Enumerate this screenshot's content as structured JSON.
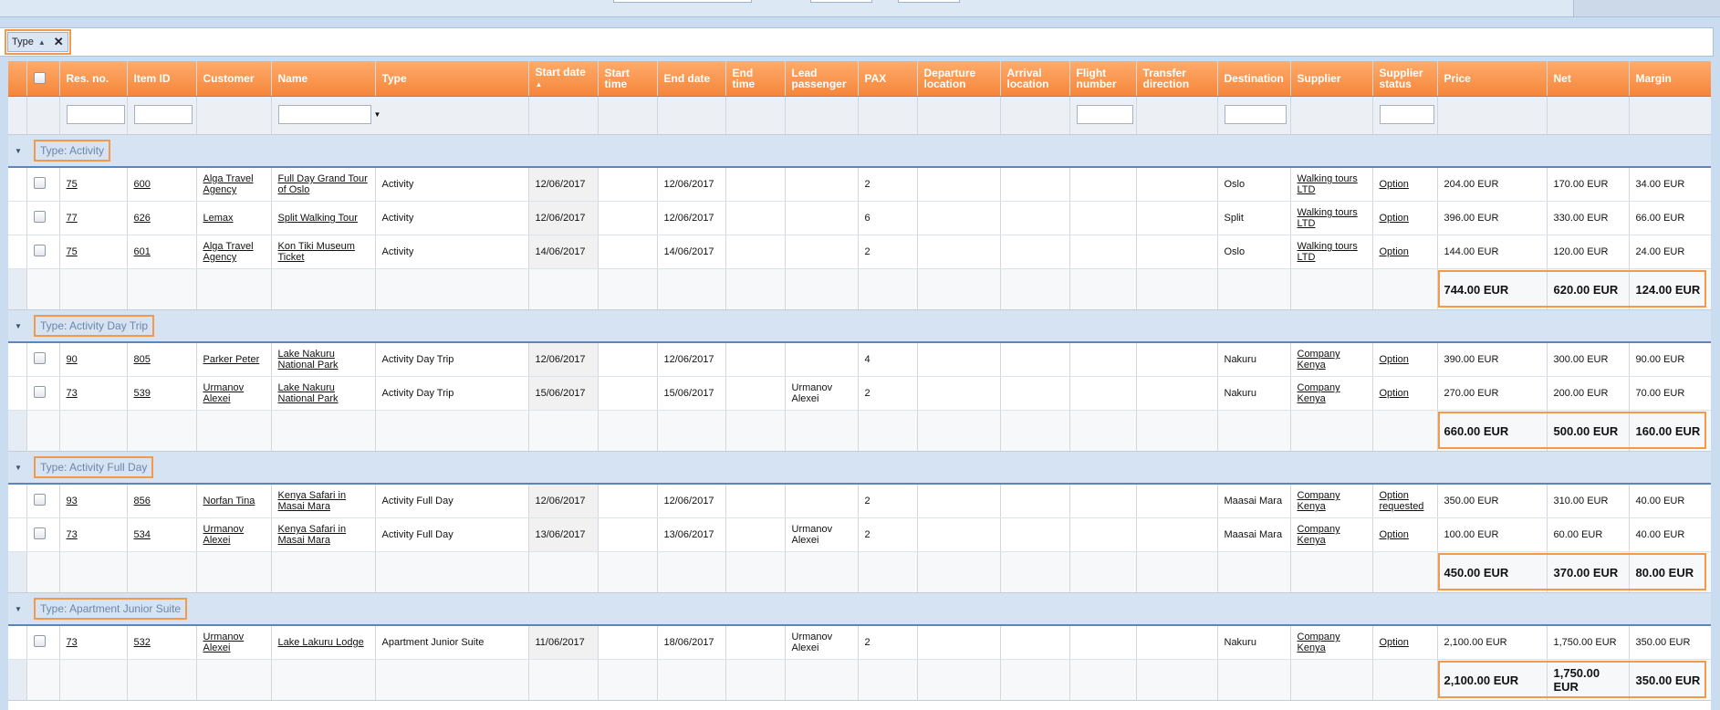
{
  "group_panel": {
    "chip_label": "Type"
  },
  "columns": [
    "",
    "",
    "Res. no.",
    "Item ID",
    "Customer",
    "Name",
    "Type",
    "Start date",
    "Start time",
    "End date",
    "End time",
    "Lead passenger",
    "PAX",
    "Departure location",
    "Arrival location",
    "Flight number",
    "Transfer direction",
    "Destination",
    "Supplier",
    "Supplier status",
    "Price",
    "Net",
    "Margin"
  ],
  "groups": [
    {
      "label": "Type: Activity",
      "rows": [
        [
          "75",
          "600",
          "Alga Travel Agency",
          "Full Day Grand Tour of Oslo",
          "Activity",
          "12/06/2017",
          "",
          "12/06/2017",
          "",
          "",
          "2",
          "",
          "",
          "",
          "",
          "Oslo",
          "Walking tours LTD",
          "Option",
          "204.00 EUR",
          "170.00 EUR",
          "34.00 EUR"
        ],
        [
          "77",
          "626",
          "Lemax",
          "Split Walking Tour",
          "Activity",
          "12/06/2017",
          "",
          "12/06/2017",
          "",
          "",
          "6",
          "",
          "",
          "",
          "",
          "Split",
          "Walking tours LTD",
          "Option",
          "396.00 EUR",
          "330.00 EUR",
          "66.00 EUR"
        ],
        [
          "75",
          "601",
          "Alga Travel Agency",
          "Kon Tiki Museum Ticket",
          "Activity",
          "14/06/2017",
          "",
          "14/06/2017",
          "",
          "",
          "2",
          "",
          "",
          "",
          "",
          "Oslo",
          "Walking tours LTD",
          "Option",
          "144.00 EUR",
          "120.00 EUR",
          "24.00 EUR"
        ]
      ],
      "totals": {
        "price": "744.00 EUR",
        "net": "620.00 EUR",
        "margin": "124.00 EUR"
      }
    },
    {
      "label": "Type: Activity Day Trip",
      "rows": [
        [
          "90",
          "805",
          "Parker Peter",
          "Lake Nakuru National Park",
          "Activity Day Trip",
          "12/06/2017",
          "",
          "12/06/2017",
          "",
          "",
          "4",
          "",
          "",
          "",
          "",
          "Nakuru",
          "Company Kenya",
          "Option",
          "390.00 EUR",
          "300.00 EUR",
          "90.00 EUR"
        ],
        [
          "73",
          "539",
          "Urmanov Alexei",
          "Lake Nakuru National Park",
          "Activity Day Trip",
          "15/06/2017",
          "",
          "15/06/2017",
          "",
          "Urmanov Alexei",
          "2",
          "",
          "",
          "",
          "",
          "Nakuru",
          "Company Kenya",
          "Option",
          "270.00 EUR",
          "200.00 EUR",
          "70.00 EUR"
        ]
      ],
      "totals": {
        "price": "660.00 EUR",
        "net": "500.00 EUR",
        "margin": "160.00 EUR"
      }
    },
    {
      "label": "Type: Activity Full Day",
      "rows": [
        [
          "93",
          "856",
          "Norfan Tina",
          "Kenya Safari in Masai Mara",
          "Activity Full Day",
          "12/06/2017",
          "",
          "12/06/2017",
          "",
          "",
          "2",
          "",
          "",
          "",
          "",
          "Maasai Mara",
          "Company Kenya",
          "Option requested",
          "350.00 EUR",
          "310.00 EUR",
          "40.00 EUR"
        ],
        [
          "73",
          "534",
          "Urmanov Alexei",
          "Kenya Safari in Masai Mara",
          "Activity Full Day",
          "13/06/2017",
          "",
          "13/06/2017",
          "",
          "Urmanov Alexei",
          "2",
          "",
          "",
          "",
          "",
          "Maasai Mara",
          "Company Kenya",
          "Option",
          "100.00 EUR",
          "60.00 EUR",
          "40.00 EUR"
        ]
      ],
      "totals": {
        "price": "450.00 EUR",
        "net": "370.00 EUR",
        "margin": "80.00 EUR"
      }
    },
    {
      "label": "Type: Apartment Junior Suite",
      "rows": [
        [
          "73",
          "532",
          "Urmanov Alexei",
          "Lake Lakuru Lodge",
          "Apartment Junior Suite",
          "11/06/2017",
          "",
          "18/06/2017",
          "",
          "Urmanov Alexei",
          "2",
          "",
          "",
          "",
          "",
          "Nakuru",
          "Company Kenya",
          "Option",
          "2,100.00 EUR",
          "1,750.00 EUR",
          "350.00 EUR"
        ]
      ],
      "totals": {
        "price": "2,100.00 EUR",
        "net": "1,750.00 EUR",
        "margin": "350.00 EUR"
      }
    }
  ],
  "colors": {
    "header_orange": "#f5863a",
    "group_blue": "#d6e3f3",
    "highlight": "#f29a4a"
  }
}
